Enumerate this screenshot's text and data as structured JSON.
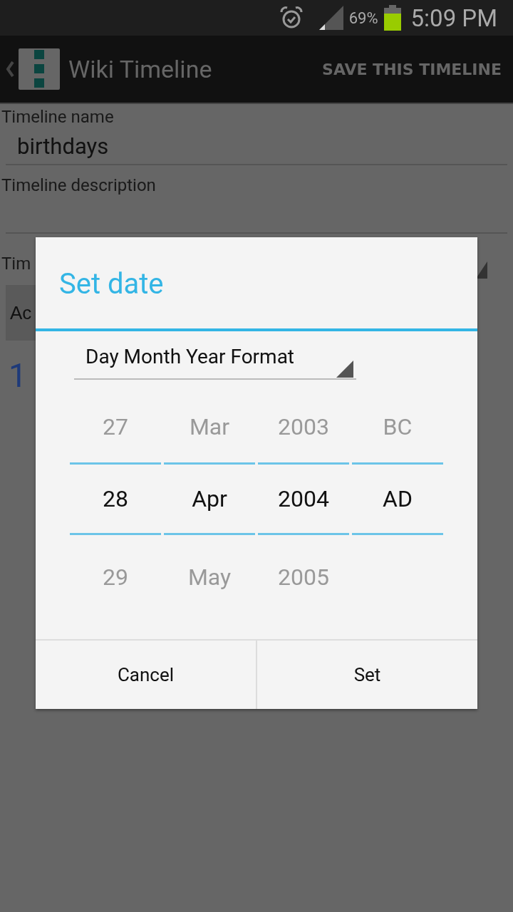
{
  "status_bar": {
    "battery_percent": "69%",
    "time": "5:09 PM"
  },
  "action_bar": {
    "title": "Wiki Timeline",
    "action": "SAVE THIS TIMELINE"
  },
  "form": {
    "fields": [
      {
        "label": "Timeline name",
        "value": "birthdays"
      },
      {
        "label": "Timeline description"
      }
    ],
    "partial_label": "Tim",
    "partial_button": "Ac",
    "partial_number": "1"
  },
  "dialog": {
    "title": "Set date",
    "format_spinner": "Day Month Year Format",
    "columns": [
      {
        "above": "27",
        "value": "28",
        "below": "29"
      },
      {
        "above": "Mar",
        "value": "Apr",
        "below": "May"
      },
      {
        "above": "2003",
        "value": "2004",
        "below": "2005"
      },
      {
        "above": "BC",
        "value": "AD"
      }
    ],
    "buttons": [
      "Cancel",
      "Set"
    ]
  }
}
